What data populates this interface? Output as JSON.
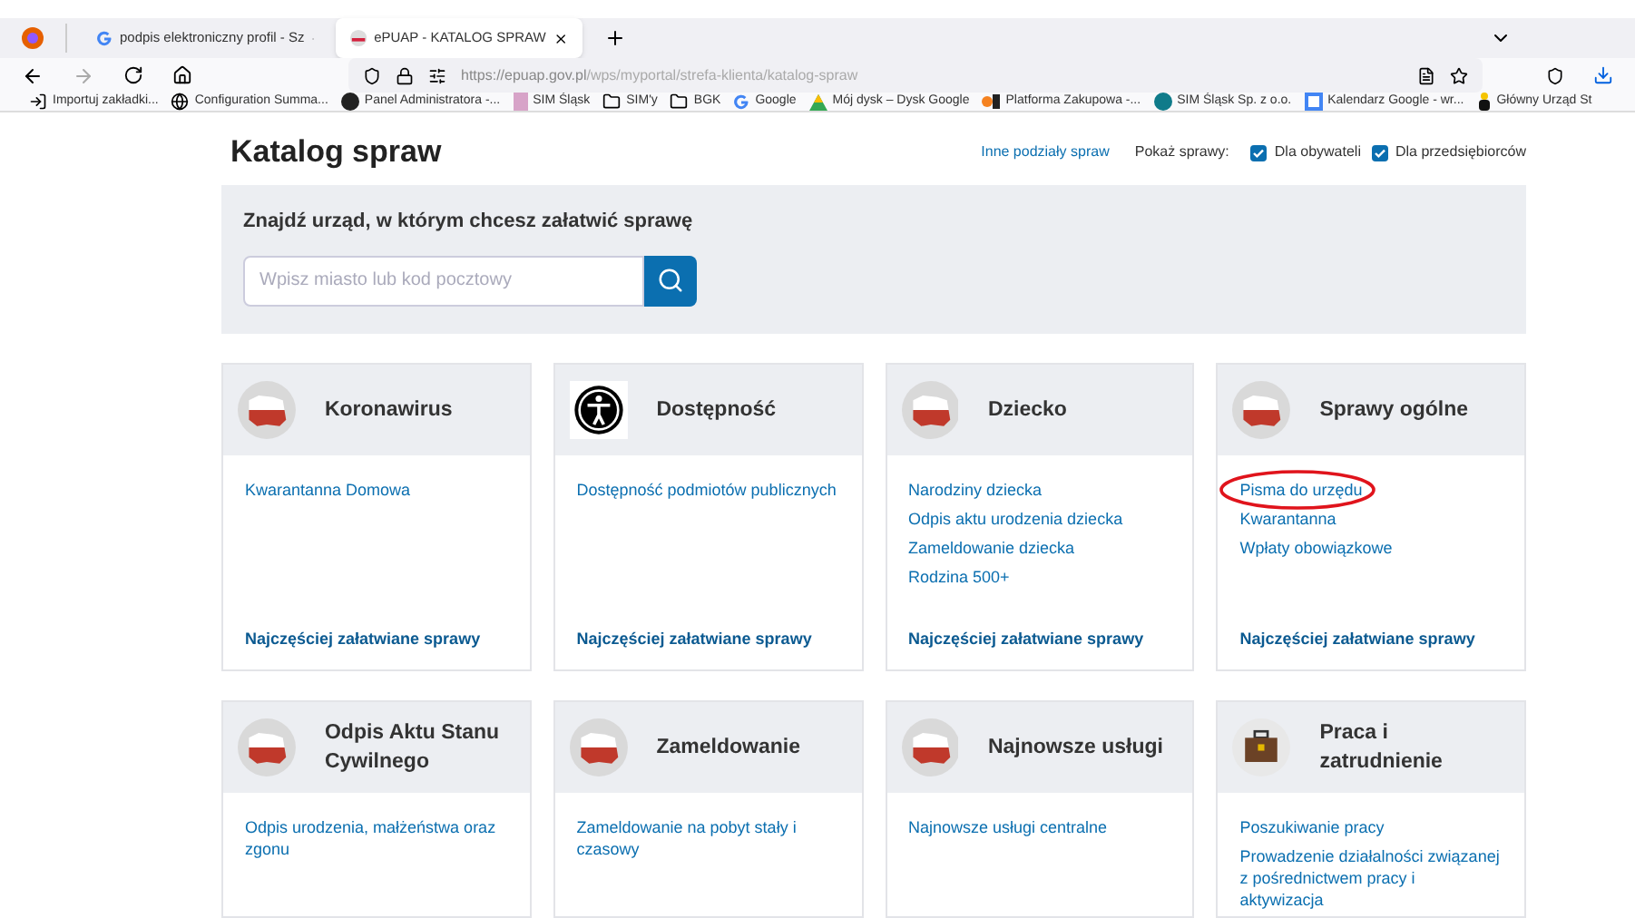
{
  "browser": {
    "tabs": [
      {
        "title": "podpis elektroniczny profil - Sz",
        "selected": false
      },
      {
        "title": "ePUAP - KATALOG SPRAW",
        "selected": true
      }
    ],
    "url": {
      "host": "https://epuap.gov.pl",
      "path": "/wps/myportal/strefa-klienta/katalog-spraw"
    },
    "bookmarks": [
      {
        "label": "Importuj zakładki..."
      },
      {
        "label": "Configuration Summa..."
      },
      {
        "label": "Panel Administratora -..."
      },
      {
        "label": "SIM Śląsk"
      },
      {
        "label": "SIM'y"
      },
      {
        "label": "BGK"
      },
      {
        "label": "Google"
      },
      {
        "label": "Mój dysk – Dysk Google"
      },
      {
        "label": "Platforma Zakupowa -..."
      },
      {
        "label": "SIM Śląsk Sp. z o.o."
      },
      {
        "label": "Kalendarz Google - wr..."
      },
      {
        "label": "Główny Urząd St"
      }
    ]
  },
  "page": {
    "title": "Katalog spraw",
    "other_link": "Inne podziały spraw",
    "show_label": "Pokaż sprawy:",
    "filters": [
      {
        "label": "Dla obywateli",
        "checked": true
      },
      {
        "label": "Dla przedsiębiorców",
        "checked": true
      }
    ],
    "search": {
      "heading": "Znajdź urząd, w którym chcesz załatwić sprawę",
      "placeholder": "Wpisz miasto lub kod pocztowy"
    },
    "categories": [
      {
        "title": "Koronawirus",
        "kind": "map",
        "links": [
          {
            "text": "Kwarantanna Domowa",
            "circled": false
          }
        ],
        "footer": "Najczęściej załatwiane sprawy"
      },
      {
        "title": "Dostępność",
        "kind": "accessibility",
        "links": [
          {
            "text": "Dostępność podmiotów publicznych",
            "circled": false
          }
        ],
        "footer": "Najczęściej załatwiane sprawy"
      },
      {
        "title": "Dziecko",
        "kind": "map",
        "links": [
          {
            "text": "Narodziny dziecka",
            "circled": false
          },
          {
            "text": "Odpis aktu urodzenia dziecka",
            "circled": false
          },
          {
            "text": "Zameldowanie dziecka",
            "circled": false
          },
          {
            "text": "Rodzina 500+",
            "circled": false
          }
        ],
        "footer": "Najczęściej załatwiane sprawy"
      },
      {
        "title": "Sprawy ogólne",
        "kind": "map",
        "links": [
          {
            "text": "Pisma do urzędu",
            "circled": true
          },
          {
            "text": "Kwarantanna",
            "circled": false
          },
          {
            "text": "Wpłaty obowiązkowe",
            "circled": false
          }
        ],
        "footer": "Najczęściej załatwiane sprawy"
      },
      {
        "title": "Odpis Aktu Stanu Cywilnego",
        "kind": "map",
        "links": [
          {
            "text": "Odpis urodzenia, małżeństwa oraz zgonu",
            "circled": false
          }
        ]
      },
      {
        "title": "Zameldowanie",
        "kind": "map",
        "links": [
          {
            "text": "Zameldowanie na pobyt stały i czasowy",
            "circled": false
          }
        ]
      },
      {
        "title": "Najnowsze usługi",
        "kind": "map",
        "links": [
          {
            "text": "Najnowsze usługi centralne",
            "circled": false
          }
        ]
      },
      {
        "title": "Praca i zatrudnienie",
        "kind": "briefcase",
        "links": [
          {
            "text": "Poszukiwanie pracy",
            "circled": false
          },
          {
            "text": "Prowadzenie działalności związanej z pośrednictwem pracy i aktywizacja",
            "circled": false
          }
        ]
      }
    ]
  }
}
